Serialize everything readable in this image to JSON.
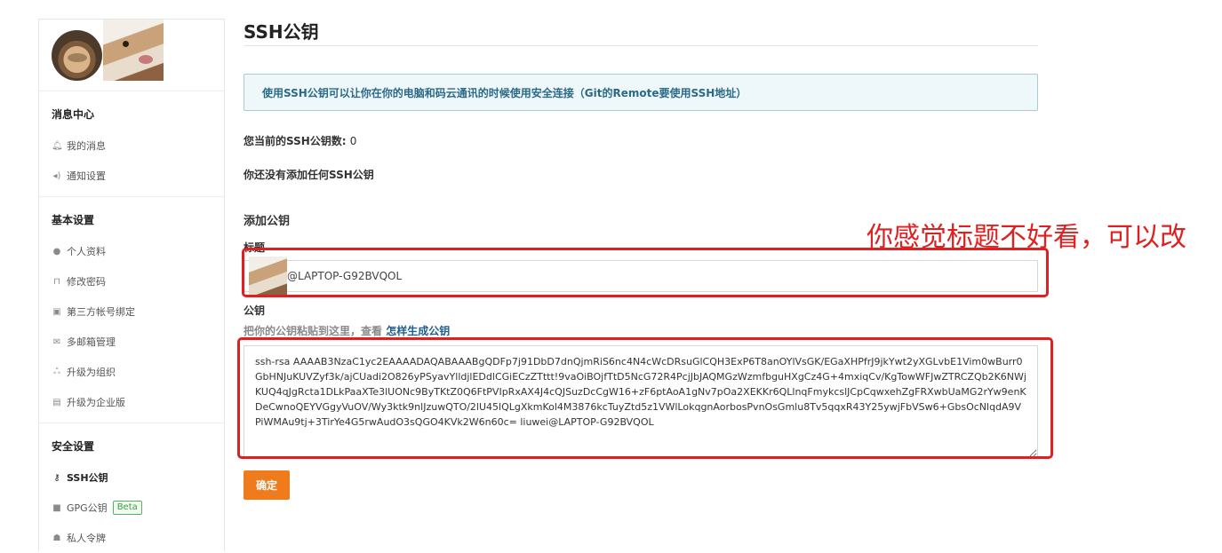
{
  "sidebar": {
    "groups": [
      {
        "title": "消息中心",
        "items": [
          {
            "label": "我的消息",
            "icon": "bell-icon"
          },
          {
            "label": "通知设置",
            "icon": "speaker-icon"
          }
        ]
      },
      {
        "title": "基本设置",
        "items": [
          {
            "label": "个人资料",
            "icon": "user-icon"
          },
          {
            "label": "修改密码",
            "icon": "unlock-icon"
          },
          {
            "label": "第三方帐号绑定",
            "icon": "bind-icon"
          },
          {
            "label": "多邮箱管理",
            "icon": "mail-icon"
          },
          {
            "label": "升级为组织",
            "icon": "group-icon"
          },
          {
            "label": "升级为企业版",
            "icon": "building-icon"
          }
        ]
      },
      {
        "title": "安全设置",
        "items": [
          {
            "label": "SSH公钥",
            "icon": "key-icon",
            "active": true
          },
          {
            "label": "GPG公钥",
            "icon": "lock-icon",
            "badge": "Beta"
          },
          {
            "label": "私人令牌",
            "icon": "token-icon"
          }
        ]
      }
    ]
  },
  "main": {
    "title": "SSH公钥",
    "notice": "使用SSH公钥可以让你在你的电脑和码云通讯的时候使用安全连接（Git的Remote要使用SSH地址）",
    "count_label": "您当前的SSH公钥数: ",
    "count_value": "0",
    "none_text": "你还没有添加任何SSH公钥",
    "add_title": "添加公钥",
    "title_label": "标题",
    "title_value": "@LAPTOP-G92BVQOL",
    "key_label": "公钥",
    "key_hint": "把你的公钥粘贴到这里，查看 ",
    "key_hint_link": "怎样生成公钥",
    "key_value": "ssh-rsa AAAAB3NzaC1yc2EAAAADAQABAAABgQDFp7j91DbD7dnQjmRiS6nc4N4cWcDRsuGlCQH3ExP6T8anOYlVsGK/EGaXHPfrJ9jkYwt2yXGLvbE1Vim0wBurr0GbHNJuKUVZyf3k/ajCUadi2O826yPSyavYlldjlEDdlCGiECzZTttt!9vaOiBOjfTtD5NcG72R4PcjJbJAQMGzWzmfbguHXgCz4G+4mxiqCv/KgTowWFJwZTRCZQb2K6NWjKUQ4qJgRcta1DLkPaaXTe3lUONc9ByTKtZ0Q6FtPVIpRxAX4J4cQJSuzDcCgW16+zF6ptAoA1gNv7pOa2XEKKr6QLlnqFmykcslJCpCqwxehZgFRXwbUaMG2rYw9enKDeCwnoQEYVGgyVuOV/Wy3ktk9nlJzuwQTO/2lU45lQLgXkmKol4M3876kcTuyZtd5z1VWlLokqgnAorbosPvnOsGmlu8Tv5qqxR43Y25ywjFbVSw6+GbsOcNlqdA9VPiWMAu9tj+3TirYe4G5rwAudO3sQGO4KVk2W6n60c= liuwei@LAPTOP-G92BVQOL",
    "confirm_label": "确定"
  },
  "annotation": {
    "text": "你感觉标题不好看，可以改",
    "color": "#e02020"
  }
}
